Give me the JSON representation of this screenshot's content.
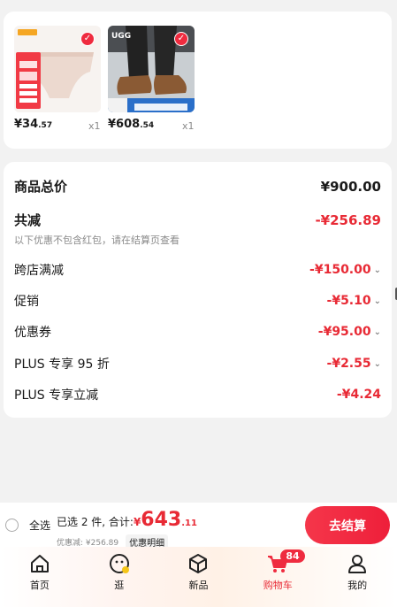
{
  "products": [
    {
      "price_yen": "¥",
      "price_int": "34",
      "price_dec": ".57",
      "qty": "x1",
      "selected": true,
      "image": "underwear-product-image"
    },
    {
      "price_yen": "¥",
      "price_int": "608",
      "price_dec": ".54",
      "qty": "x1",
      "selected": true,
      "image": "ugg-shoes-product-image"
    }
  ],
  "summary": {
    "goods_total_label": "商品总价",
    "goods_total_value": "¥900.00",
    "reduce_label": "共减",
    "reduce_value": "-¥256.89",
    "reduce_hint": "以下优惠不包含红包，请在结算页查看",
    "items": [
      {
        "label": "跨店满减",
        "value": "-¥150.00",
        "expandable": true
      },
      {
        "label": "促销",
        "value": "-¥5.10",
        "expandable": true
      },
      {
        "label": "优惠券",
        "value": "-¥95.00",
        "expandable": true
      },
      {
        "label": "PLUS 专享 95 折",
        "value": "-¥2.55",
        "expandable": true
      },
      {
        "label": "PLUS 专享立减",
        "value": "-¥4.24",
        "expandable": false
      }
    ]
  },
  "checkout_bar": {
    "select_all_label": "全选",
    "selected_text": "已选 2 件, 合计: ",
    "total_yen": "¥",
    "total_int": "643",
    "total_dec": ".11",
    "discount_text": "优惠减: ¥256.89",
    "detail_label": "优惠明细",
    "checkout_label": "去结算"
  },
  "tabbar": {
    "items": [
      {
        "label": "首页",
        "icon": "home-icon"
      },
      {
        "label": "逛",
        "icon": "browse-icon"
      },
      {
        "label": "新品",
        "icon": "new-products-icon"
      },
      {
        "label": "购物车",
        "icon": "cart-icon",
        "active": true,
        "badge": "84"
      },
      {
        "label": "我的",
        "icon": "profile-icon"
      }
    ]
  },
  "colors": {
    "accent": "#e82a35",
    "background": "#f2f2f2"
  }
}
